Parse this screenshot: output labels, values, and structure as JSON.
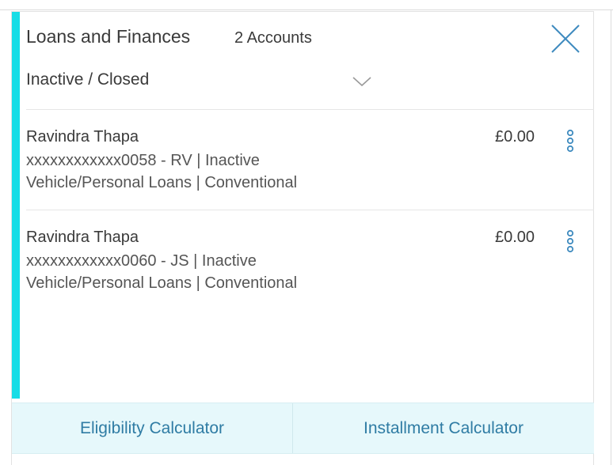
{
  "header": {
    "title": "Loans and Finances",
    "count": "2 Accounts"
  },
  "filter": {
    "selected": "Inactive / Closed"
  },
  "accounts": [
    {
      "name": "Ravindra Thapa",
      "account": "xxxxxxxxxxxx0058 - RV | Inactive",
      "type": "Vehicle/Personal Loans | Conventional",
      "amount": "£0.00"
    },
    {
      "name": "Ravindra Thapa",
      "account": "xxxxxxxxxxxx0060 - JS | Inactive",
      "type": "Vehicle/Personal Loans | Conventional",
      "amount": "£0.00"
    }
  ],
  "footer": {
    "eligibility_label": "Eligibility Calculator",
    "installment_label": "Installment Calculator"
  },
  "colors": {
    "accent": "#16dde6",
    "link": "#2f7ca4",
    "icon": "#3f8bbf",
    "footer_bg": "#e6f8fb"
  },
  "icons": {
    "close": "close-icon",
    "dropdown": "chevron-down-icon",
    "more": "more-vertical-icon"
  }
}
